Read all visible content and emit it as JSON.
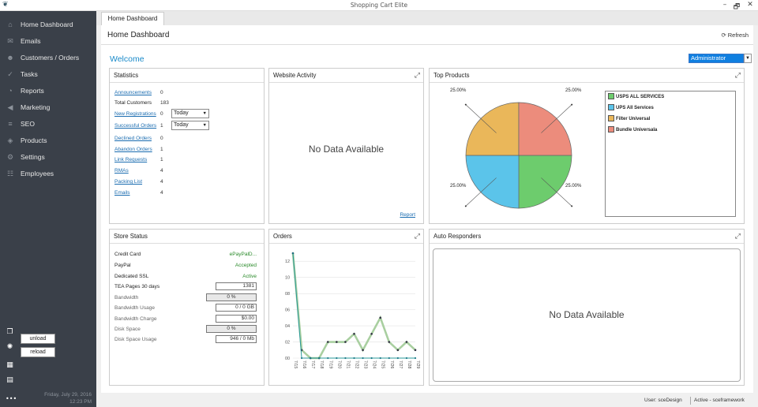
{
  "window": {
    "title": "Shopping Cart Elite",
    "minimize": "–",
    "restore": "🗗",
    "close": "✕"
  },
  "sidebar": {
    "items": [
      {
        "label": "Home Dashboard",
        "icon": "home-icon",
        "glyph": "⌂"
      },
      {
        "label": "Emails",
        "icon": "mail-icon",
        "glyph": "✉"
      },
      {
        "label": "Customers / Orders",
        "icon": "user-icon",
        "glyph": "☻"
      },
      {
        "label": "Tasks",
        "icon": "tasks-icon",
        "glyph": "✓"
      },
      {
        "label": "Reports",
        "icon": "chart-icon",
        "glyph": "◔"
      },
      {
        "label": "Marketing",
        "icon": "megaphone-icon",
        "glyph": "◀"
      },
      {
        "label": "SEO",
        "icon": "sliders-icon",
        "glyph": "≡"
      },
      {
        "label": "Products",
        "icon": "tag-icon",
        "glyph": "◈"
      },
      {
        "label": "Settings",
        "icon": "gear-icon",
        "glyph": "⚙"
      },
      {
        "label": "Employees",
        "icon": "group-icon",
        "glyph": "☷"
      }
    ],
    "unload_label": "unload",
    "reload_label": "reload",
    "date": "Friday, July 29, 2016",
    "time": "12:23 PM",
    "more": "•••"
  },
  "tabs": [
    {
      "label": "Home Dashboard"
    }
  ],
  "header": {
    "title": "Home Dashboard",
    "refresh_label": "Refresh"
  },
  "welcome": "Welcome",
  "role_select": {
    "value": "Administrator"
  },
  "statistics": {
    "title": "Statistics",
    "rows": [
      {
        "label": "Announcements",
        "value": "0",
        "link": true
      },
      {
        "label": "Total Customers",
        "value": "183",
        "link": false
      },
      {
        "label": "New Registrations",
        "value": "0",
        "link": true,
        "select": "Today"
      },
      {
        "label": "Successful Orders",
        "value": "1",
        "link": true,
        "select": "Today"
      },
      {
        "label": "Declined Orders",
        "value": "0",
        "link": true
      },
      {
        "label": "Abandon Orders",
        "value": "1",
        "link": true
      },
      {
        "label": "Link Requests",
        "value": "1",
        "link": true
      },
      {
        "label": "RMAs",
        "value": "4",
        "link": true
      },
      {
        "label": "Packing List",
        "value": "4",
        "link": true
      },
      {
        "label": "Emails",
        "value": "4",
        "link": true
      }
    ]
  },
  "website_activity": {
    "title": "Website Activity",
    "no_data": "No Data Available",
    "report_link": "Report"
  },
  "top_products": {
    "title": "Top Products",
    "slice_labels": [
      "25.00%",
      "25.00%",
      "25.00%",
      "25.00%"
    ]
  },
  "store_status": {
    "title": "Store Status",
    "rows": [
      {
        "label": "Credit Card",
        "value": "ePayPalD...",
        "kind": "text"
      },
      {
        "label": "PayPal",
        "value": "Accepted",
        "kind": "text"
      },
      {
        "label": "Dedicated SSL",
        "value": "Active",
        "kind": "text"
      },
      {
        "label": "TEA Pages 30 days",
        "value": "1381",
        "kind": "box"
      },
      {
        "label": "Bandwidth",
        "value": "0 %",
        "kind": "bar"
      },
      {
        "label": "Bandwidth Usage",
        "value": "0 / 0 GB",
        "kind": "box"
      },
      {
        "label": "Bandwidth Charge",
        "value": "$0.00",
        "kind": "box"
      },
      {
        "label": "Disk Space",
        "value": "0 %",
        "kind": "bar"
      },
      {
        "label": "Disk Space Usage",
        "value": "946 / 0 Mb",
        "kind": "box"
      }
    ]
  },
  "orders": {
    "title": "Orders"
  },
  "auto_responders": {
    "title": "Auto Responders",
    "no_data": "No Data Available"
  },
  "status_bar": {
    "user": "User: sceDesign",
    "active": "Active - sceframework"
  },
  "colors": {
    "sidebar": "#3a4049",
    "accent": "#1a8ac9",
    "pie_green": "#6dcc6d",
    "pie_blue": "#5bc4ea",
    "pie_orange": "#eab75a",
    "pie_red": "#ec8c7c"
  },
  "chart_data": [
    {
      "type": "pie",
      "title": "",
      "categories": [
        "USPS ALL SERVICES",
        "UPS All Services",
        "Filter Universal",
        "Bundle Universala"
      ],
      "values": [
        25,
        25,
        25,
        25
      ],
      "colors": [
        "#6dcc6d",
        "#5bc4ea",
        "#eab75a",
        "#ec8c7c"
      ],
      "legend": "right"
    },
    {
      "type": "line",
      "title": "",
      "categories": [
        "7/15",
        "7/16",
        "7/17",
        "7/18",
        "7/19",
        "7/20",
        "7/21",
        "7/22",
        "7/23",
        "7/24",
        "7/25",
        "7/26",
        "7/27",
        "7/28",
        "7/29"
      ],
      "series": [
        {
          "values": [
            13,
            1,
            0,
            0,
            2,
            2,
            2,
            3,
            1,
            3,
            5,
            2,
            1,
            2,
            1
          ],
          "color": "#a9cfa0"
        },
        {
          "values": [
            13,
            0,
            0,
            0,
            0,
            0,
            0,
            0,
            0,
            0,
            0,
            0,
            0,
            0,
            0
          ],
          "color": "#2a9a9a"
        }
      ],
      "yticks": [
        "00",
        "02",
        "04",
        "06",
        "08",
        "10",
        "12"
      ],
      "ylim": [
        0,
        13
      ],
      "grid": true
    }
  ]
}
